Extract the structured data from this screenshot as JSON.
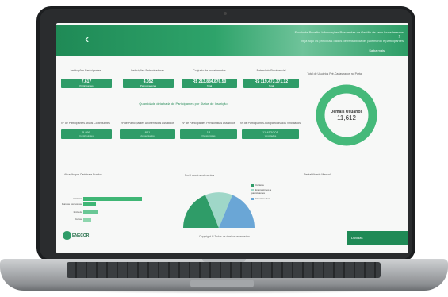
{
  "hero": {
    "title": "Fundo de Pensão: Informações Resumidas da Gestão de seus Investimentos",
    "subtitle": "Veja aqui os principais dados de rentabilidade, patrimônio e participantes",
    "link": "Saiba mais"
  },
  "kpis": [
    {
      "label": "Instituições Participantes",
      "value": "7.617",
      "sub": "Participantes"
    },
    {
      "label": "Instituições Patrocinadoras",
      "value": "4.052",
      "sub": "Patrocinadores"
    },
    {
      "label": "Conjunto de Investimentos",
      "value": "R$ 213.884.876,50",
      "sub": "Total"
    },
    {
      "label": "Patrimônio Previdencial",
      "value": "R$ 119.473.371,12",
      "sub": "Total"
    }
  ],
  "section_title": "Quantidade detalhada de Participantes por Status de Inscrição",
  "kpis2": [
    {
      "label": "Nº de Participantes Ativos Contribuintes",
      "value": "5.890",
      "sub": "Contribuintes"
    },
    {
      "label": "Nº de Participantes Aposentados Assistidos",
      "value": "821",
      "sub": "Aposentados"
    },
    {
      "label": "Nº de Participantes Pensionistas Assistidos",
      "value": "14",
      "sub": "Pensionistas"
    },
    {
      "label": "Nº de Participantes Autopatrocinados Vinculados",
      "value": "11.452/201",
      "sub": "Vinculados"
    }
  ],
  "donut": {
    "title": "Total de Usuários Pré-Cadastrados no Portal",
    "label": "Demais Usuários",
    "value": "11,612",
    "color": "#45b97a"
  },
  "bars_panel": {
    "title": "Atuação por Carteira e Fundos",
    "items": [
      {
        "label": "Carteira",
        "value": 0.7
      },
      {
        "label": "Fundos Exclusivos",
        "value": 0.15
      },
      {
        "label": "Imóveis",
        "value": 0.22
      },
      {
        "label": "Outros",
        "value": 0.08
      }
    ]
  },
  "pie_panel": {
    "title": "Perfil dos Investimentos",
    "legend": [
      {
        "label": "Carteira",
        "color": "#2f9c68"
      },
      {
        "label": "Empréstimos a participantes",
        "color": "#9fd7c8"
      },
      {
        "label": "Investimentos",
        "color": "#6aa6d6"
      }
    ],
    "slices": [
      0.55,
      0.25,
      0.2
    ]
  },
  "third_panel": {
    "title": "Rentabilidade Mensal"
  },
  "footer": {
    "logo": "ENECOR",
    "copyright": "Copyright © Todos os direitos reservados",
    "button": "Dúvidas"
  }
}
